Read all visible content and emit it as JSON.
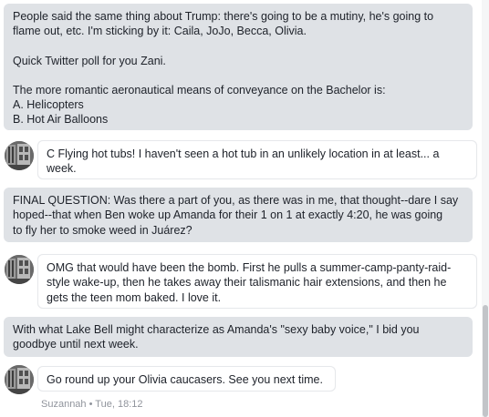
{
  "messages": {
    "m1": {
      "line1": "People said the same thing about Trump: there's going to be a mutiny, he's going to",
      "line2": "flame out, etc. I'm sticking by it: Caila, JoJo, Becca, Olivia.",
      "line3": "Quick Twitter poll for you Zani.",
      "line4": "The more romantic aeronautical means of conveyance on the Bachelor is:",
      "line5": "A. Helicopters",
      "line6": "B. Hot Air Balloons"
    },
    "m2": {
      "line1": "C Flying hot tubs! I haven't seen a hot tub in an unlikely location in at least... a",
      "line2": "week."
    },
    "m3": {
      "line1": "FINAL QUESTION: Was there a part of you, as there was in me, that thought--dare I say",
      "line2": "hoped--that when Ben woke up Amanda for their 1 on 1 at exactly 4:20, he was going",
      "line3": "to fly her to smoke weed in Juárez?"
    },
    "m4": {
      "line1": "OMG that would have been the bomb. First he pulls a summer-camp-panty-raid-",
      "line2": "style wake-up, then he takes away their talismanic hair extensions, and then he",
      "line3": "gets the teen mom baked. I love it."
    },
    "m5": {
      "line1": "With what Lake Bell might characterize as Amanda's \"sexy baby voice,\" I bid you",
      "line2": "goodbye until next week."
    },
    "m6": {
      "line1": "Go round up your Olivia caucasers. See you next time."
    },
    "meta": "Suzannah • Tue, 18:12"
  },
  "colors": {
    "outgoing_bubble": "#dfe2e6",
    "incoming_bubble": "#ffffff",
    "meta_text": "#90949c"
  },
  "icons": {
    "avatar": "avatar-photo"
  }
}
